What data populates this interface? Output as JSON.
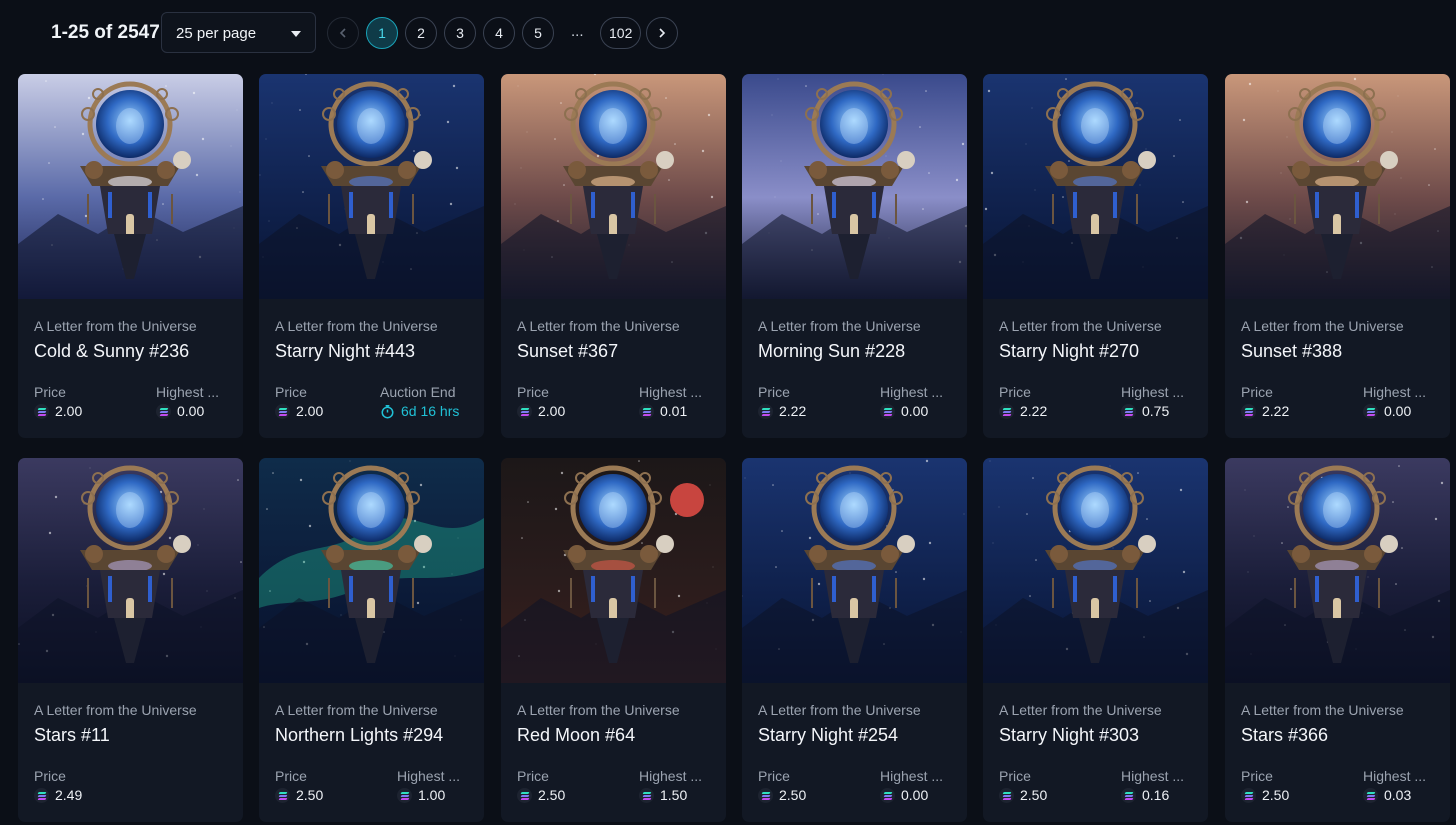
{
  "pagination": {
    "range_text": "1-25 of 2547",
    "per_page": "25 per page",
    "pages": [
      "1",
      "2",
      "3",
      "4",
      "5"
    ],
    "ellipsis": "...",
    "last_page": "102",
    "current_page": "1"
  },
  "colors": {
    "background": "#0b0f17",
    "card": "#121824",
    "accent": "#1aa3b8",
    "timer": "#20c1d6"
  },
  "cards": [
    {
      "collection": "A Letter from the Universe",
      "title": "Cold & Sunny #236",
      "price_label": "Price",
      "price": "2.00",
      "second_label": "Highest ...",
      "second_value": "0.00",
      "theme": "cold-sunny"
    },
    {
      "collection": "A Letter from the Universe",
      "title": "Starry Night #443",
      "price_label": "Price",
      "price": "2.00",
      "second_label": "Auction End",
      "second_value": "6d 16 hrs",
      "theme": "starry-night"
    },
    {
      "collection": "A Letter from the Universe",
      "title": "Sunset #367",
      "price_label": "Price",
      "price": "2.00",
      "second_label": "Highest ...",
      "second_value": "0.01",
      "theme": "sunset"
    },
    {
      "collection": "A Letter from the Universe",
      "title": "Morning Sun #228",
      "price_label": "Price",
      "price": "2.22",
      "second_label": "Highest ...",
      "second_value": "0.00",
      "theme": "morning-sun"
    },
    {
      "collection": "A Letter from the Universe",
      "title": "Starry Night #270",
      "price_label": "Price",
      "price": "2.22",
      "second_label": "Highest ...",
      "second_value": "0.75",
      "theme": "starry-night"
    },
    {
      "collection": "A Letter from the Universe",
      "title": "Sunset #388",
      "price_label": "Price",
      "price": "2.22",
      "second_label": "Highest ...",
      "second_value": "0.00",
      "theme": "sunset"
    },
    {
      "collection": "A Letter from the Universe",
      "title": "Stars #11",
      "price_label": "Price",
      "price": "2.49",
      "second_label": "",
      "second_value": "",
      "theme": "stars"
    },
    {
      "collection": "A Letter from the Universe",
      "title": "Northern Lights #294",
      "price_label": "Price",
      "price": "2.50",
      "second_label": "Highest ...",
      "second_value": "1.00",
      "theme": "northern-lights"
    },
    {
      "collection": "A Letter from the Universe",
      "title": "Red Moon #64",
      "price_label": "Price",
      "price": "2.50",
      "second_label": "Highest ...",
      "second_value": "1.50",
      "theme": "red-moon"
    },
    {
      "collection": "A Letter from the Universe",
      "title": "Starry Night #254",
      "price_label": "Price",
      "price": "2.50",
      "second_label": "Highest ...",
      "second_value": "0.00",
      "theme": "starry-night"
    },
    {
      "collection": "A Letter from the Universe",
      "title": "Starry Night #303",
      "price_label": "Price",
      "price": "2.50",
      "second_label": "Highest ...",
      "second_value": "0.16",
      "theme": "starry-night"
    },
    {
      "collection": "A Letter from the Universe",
      "title": "Stars #366",
      "price_label": "Price",
      "price": "2.50",
      "second_label": "Highest ...",
      "second_value": "0.03",
      "theme": "stars"
    }
  ]
}
